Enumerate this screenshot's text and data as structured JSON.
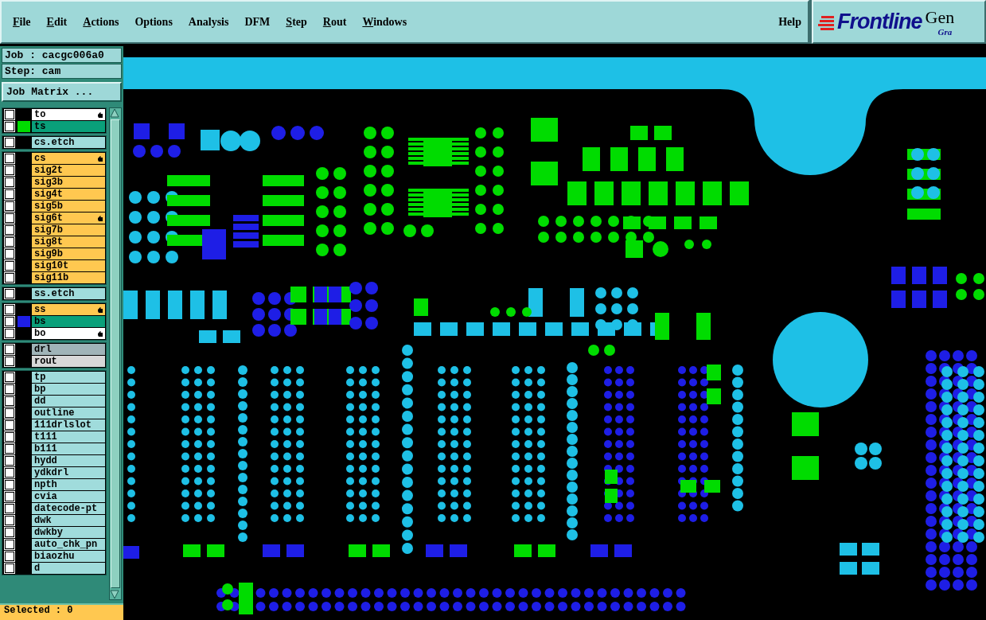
{
  "menu": [
    {
      "label": "File",
      "underlined": true
    },
    {
      "label": "Edit",
      "underlined": true
    },
    {
      "label": "Actions",
      "underlined": true
    },
    {
      "label": "Options",
      "underlined": false
    },
    {
      "label": "Analysis",
      "underlined": false
    },
    {
      "label": "DFM",
      "underlined": false
    },
    {
      "label": "Step",
      "underlined": true
    },
    {
      "label": "Rout",
      "underlined": true
    },
    {
      "label": "Windows",
      "underlined": true
    }
  ],
  "help": "Help",
  "logo": {
    "brand": "Frontline",
    "product": "Gen",
    "tagline": "Gra"
  },
  "job": "Job : cacgc006a0",
  "step": "Step: cam",
  "job_matrix_button": "Job Matrix ...",
  "layer_groups": [
    {
      "layers": [
        {
          "name": "to",
          "color": "#ffffff",
          "pointer": true,
          "checked": false
        },
        {
          "name": "ts",
          "color": "#0aa07a",
          "swatch": {
            "color": "#00dc00"
          },
          "pointer": false,
          "checked": false
        }
      ]
    },
    {
      "layers": [
        {
          "name": "cs.etch",
          "color": "#a0dcdc",
          "pointer": false,
          "checked": false
        }
      ]
    },
    {
      "layers": [
        {
          "name": "cs",
          "color": "#ffc850",
          "pointer": true,
          "checked": false
        },
        {
          "name": "sig2t",
          "color": "#ffc850",
          "pointer": false,
          "checked": false
        },
        {
          "name": "sig3b",
          "color": "#ffc850",
          "pointer": false,
          "checked": false
        },
        {
          "name": "sig4t",
          "color": "#ffc850",
          "pointer": false,
          "checked": false
        },
        {
          "name": "sig5b",
          "color": "#ffc850",
          "pointer": false,
          "checked": false
        },
        {
          "name": "sig6t",
          "color": "#ffc850",
          "pointer": true,
          "checked": false
        },
        {
          "name": "sig7b",
          "color": "#ffc850",
          "pointer": false,
          "checked": false
        },
        {
          "name": "sig8t",
          "color": "#ffc850",
          "pointer": false,
          "checked": false
        },
        {
          "name": "sig9b",
          "color": "#ffc850",
          "pointer": false,
          "checked": false
        },
        {
          "name": "sig10t",
          "color": "#ffc850",
          "pointer": false,
          "checked": false
        },
        {
          "name": "sig11b",
          "color": "#ffc850",
          "pointer": false,
          "checked": false
        }
      ]
    },
    {
      "layers": [
        {
          "name": "ss.etch",
          "color": "#a0dcdc",
          "pointer": false,
          "checked": false
        }
      ]
    },
    {
      "layers": [
        {
          "name": "ss",
          "color": "#ffc850",
          "pointer": true,
          "checked": false
        },
        {
          "name": "bs",
          "color": "#0aa07a",
          "swatch": {
            "color": "#1e1ee6"
          },
          "pointer": false,
          "checked": false
        },
        {
          "name": "bo",
          "color": "#ffffff",
          "pointer": true,
          "checked": false
        }
      ]
    },
    {
      "layers": [
        {
          "name": "drl",
          "color": "#a0b4b8",
          "pointer": false,
          "checked": false
        },
        {
          "name": "rout",
          "color": "#d8d8d8",
          "pointer": false,
          "checked": false
        }
      ]
    },
    {
      "layers": [
        {
          "name": "tp",
          "color": "#a0dcdc",
          "pointer": false,
          "checked": false
        },
        {
          "name": "bp",
          "color": "#a0dcdc",
          "pointer": false,
          "checked": false
        },
        {
          "name": "dd",
          "color": "#a0dcdc",
          "pointer": false,
          "checked": false
        },
        {
          "name": "outline",
          "color": "#a0dcdc",
          "pointer": false,
          "checked": false
        },
        {
          "name": "111drlslot",
          "color": "#a0dcdc",
          "pointer": false,
          "checked": false
        },
        {
          "name": "t111",
          "color": "#a0dcdc",
          "pointer": false,
          "checked": false
        },
        {
          "name": "b111",
          "color": "#a0dcdc",
          "pointer": false,
          "checked": false
        },
        {
          "name": "hydd",
          "color": "#a0dcdc",
          "pointer": false,
          "checked": false
        },
        {
          "name": "ydkdrl",
          "color": "#a0dcdc",
          "pointer": false,
          "checked": false
        },
        {
          "name": "npth",
          "color": "#a0dcdc",
          "pointer": false,
          "checked": false
        },
        {
          "name": "cvia",
          "color": "#a0dcdc",
          "pointer": false,
          "checked": false
        },
        {
          "name": "datecode-pt",
          "color": "#a0dcdc",
          "pointer": false,
          "checked": false
        },
        {
          "name": "dwk",
          "color": "#a0dcdc",
          "pointer": false,
          "checked": false
        },
        {
          "name": "dwkby",
          "color": "#a0dcdc",
          "pointer": false,
          "checked": false
        },
        {
          "name": "auto_chk_pn",
          "color": "#a0dcdc",
          "pointer": false,
          "checked": false
        },
        {
          "name": "biaozhu",
          "color": "#a0dcdc",
          "pointer": false,
          "checked": false
        },
        {
          "name": "d",
          "color": "#a0dcdc",
          "pointer": false,
          "checked": false
        }
      ]
    }
  ],
  "selected": "Selected : 0"
}
